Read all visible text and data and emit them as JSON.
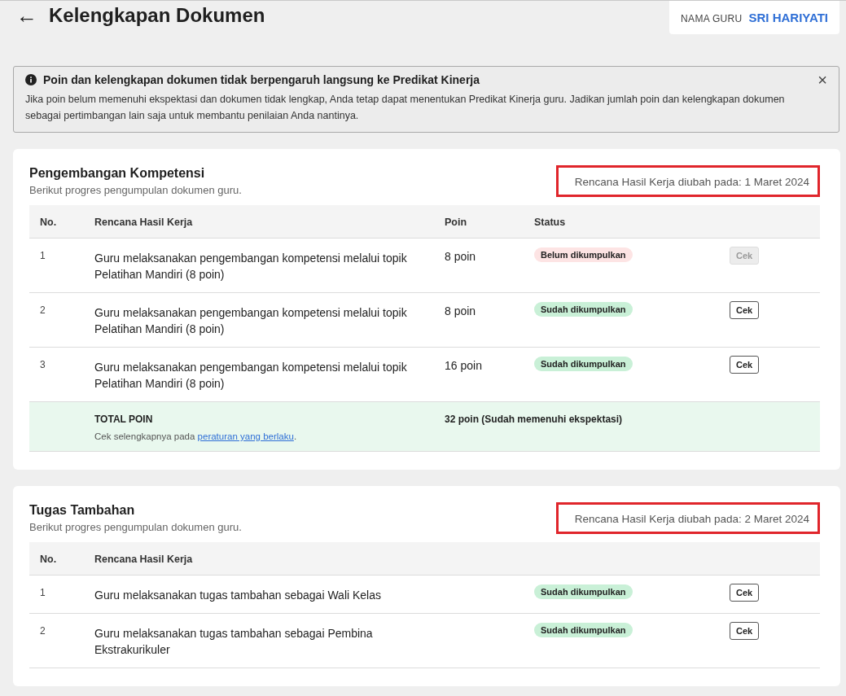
{
  "header": {
    "back_icon": "←",
    "title": "Kelengkapan Dokumen",
    "teacher_label": "NAMA GURU",
    "teacher_name": "SRI HARIYATI"
  },
  "alert": {
    "title": "Poin dan kelengkapan dokumen tidak berpengaruh langsung ke Predikat Kinerja",
    "body": "Jika poin belum memenuhi ekspektasi dan dokumen tidak lengkap, Anda tetap dapat menentukan Predikat Kinerja guru. Jadikan jumlah poin dan kelengkapan dokumen sebagai pertimbangan lain saja untuk membantu penilaian Anda nantinya.",
    "close": "×"
  },
  "sections": [
    {
      "title": "Pengembangan Kompetensi",
      "subtitle": "Berikut progres pengumpulan dokumen guru.",
      "updated": "Rencana Hasil Kerja diubah pada: 1 Maret 2024",
      "highlighted": true,
      "columns": [
        "No.",
        "Rencana Hasil Kerja",
        "Poin",
        "Status"
      ],
      "rows": [
        {
          "no": "1",
          "description": "Guru melaksanakan pengembangan kompetensi melalui topik Pelatihan Mandiri (8 poin)",
          "points": "8 poin",
          "status": {
            "label": "Belum dikumpulkan",
            "kind": "pending"
          },
          "action": {
            "label": "Cek",
            "disabled": true
          }
        },
        {
          "no": "2",
          "description": "Guru melaksanakan pengembangan kompetensi melalui topik Pelatihan Mandiri (8 poin)",
          "points": "8 poin",
          "status": {
            "label": "Sudah dikumpulkan",
            "kind": "done"
          },
          "action": {
            "label": "Cek",
            "disabled": false
          }
        },
        {
          "no": "3",
          "description": "Guru melaksanakan pengembangan kompetensi melalui topik Pelatihan Mandiri (8 poin)",
          "points": "16 poin",
          "status": {
            "label": "Sudah dikumpulkan",
            "kind": "done"
          },
          "action": {
            "label": "Cek",
            "disabled": false
          }
        }
      ],
      "total": {
        "label": "TOTAL POIN",
        "note_prefix": "Cek selengkapnya pada ",
        "note_link": "peraturan yang berlaku",
        "note_suffix": ".",
        "value": "32 poin (Sudah memenuhi ekspektasi)"
      }
    },
    {
      "title": "Tugas Tambahan",
      "subtitle": "Berikut progres pengumpulan dokumen guru.",
      "updated": "Rencana Hasil Kerja diubah pada: 2 Maret 2024",
      "highlighted": true,
      "columns": [
        "No.",
        "Rencana Hasil Kerja"
      ],
      "rows": [
        {
          "no": "1",
          "description": "Guru melaksanakan tugas tambahan sebagai Wali Kelas",
          "status": {
            "label": "Sudah dikumpulkan",
            "kind": "done"
          },
          "action": {
            "label": "Cek",
            "disabled": false
          }
        },
        {
          "no": "2",
          "description": "Guru melaksanakan tugas tambahan sebagai Pembina Ekstrakurikuler",
          "status": {
            "label": "Sudah dikumpulkan",
            "kind": "done"
          },
          "action": {
            "label": "Cek",
            "disabled": false
          }
        }
      ]
    }
  ]
}
